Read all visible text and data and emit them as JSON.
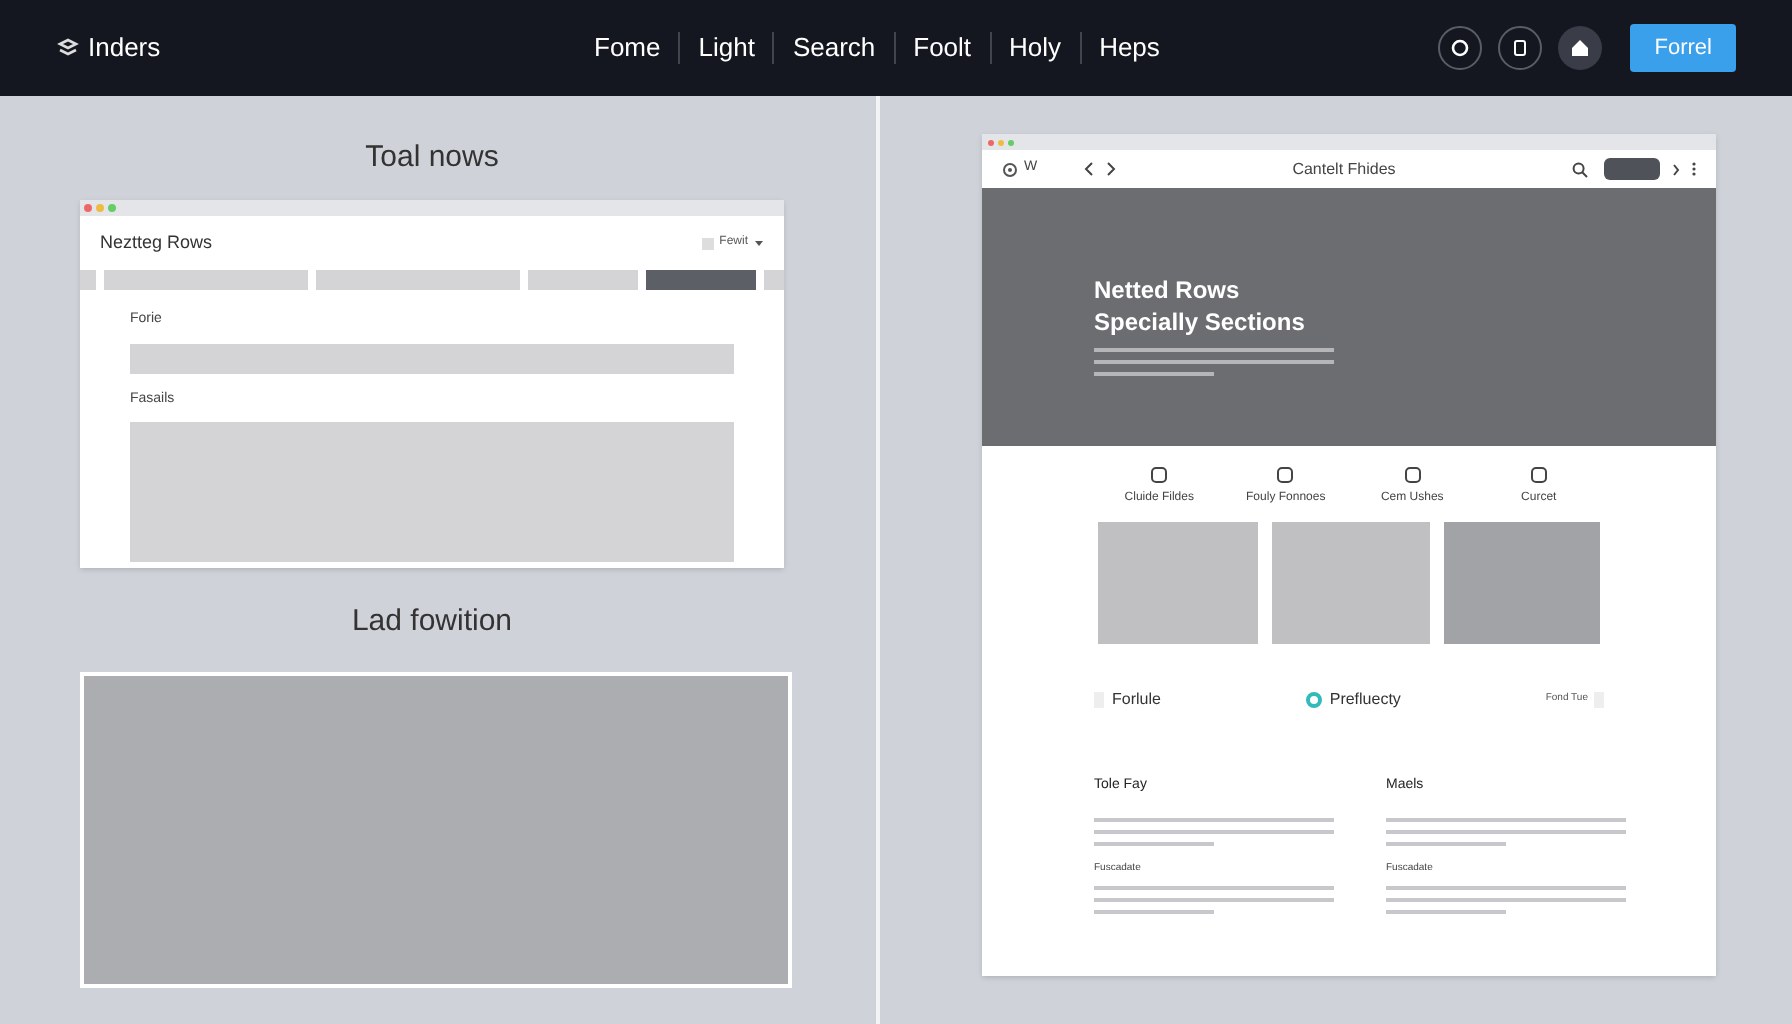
{
  "topbar": {
    "brand": "Inders",
    "nav": [
      "Fome",
      "Light",
      "Search",
      "Foolt",
      "Holy",
      "Heps"
    ],
    "action": "Forrel"
  },
  "left": {
    "heading": "Toal nows",
    "window": {
      "title": "Neztteg Rows",
      "dropdown": "Fewit",
      "tabs": [
        {
          "selected": false
        },
        {
          "selected": false
        },
        {
          "selected": false
        },
        {
          "selected": true
        }
      ],
      "fields": [
        {
          "label": "Forie",
          "kind": "line"
        },
        {
          "label": "Fasails",
          "kind": "area"
        }
      ]
    },
    "heading_2": "Lad fowition"
  },
  "right": {
    "nav_label": "W",
    "title": "Cantelt Fhides",
    "hero": {
      "title_1": "Netted Rows",
      "title_2": "Specially Sections"
    },
    "features": [
      {
        "label": "Cluide Fildes"
      },
      {
        "label": "Fouly Fonnoes"
      },
      {
        "label": "Cem Ushes"
      },
      {
        "label": "Curcet"
      }
    ],
    "strip": {
      "left": "Forlule",
      "center": "Prefluecty",
      "right": "Fond Tue"
    },
    "columns": [
      {
        "title": "Tole Fay",
        "subtitle": "Fuscadate"
      },
      {
        "title": "Maels",
        "subtitle": "Fuscadate"
      }
    ]
  }
}
